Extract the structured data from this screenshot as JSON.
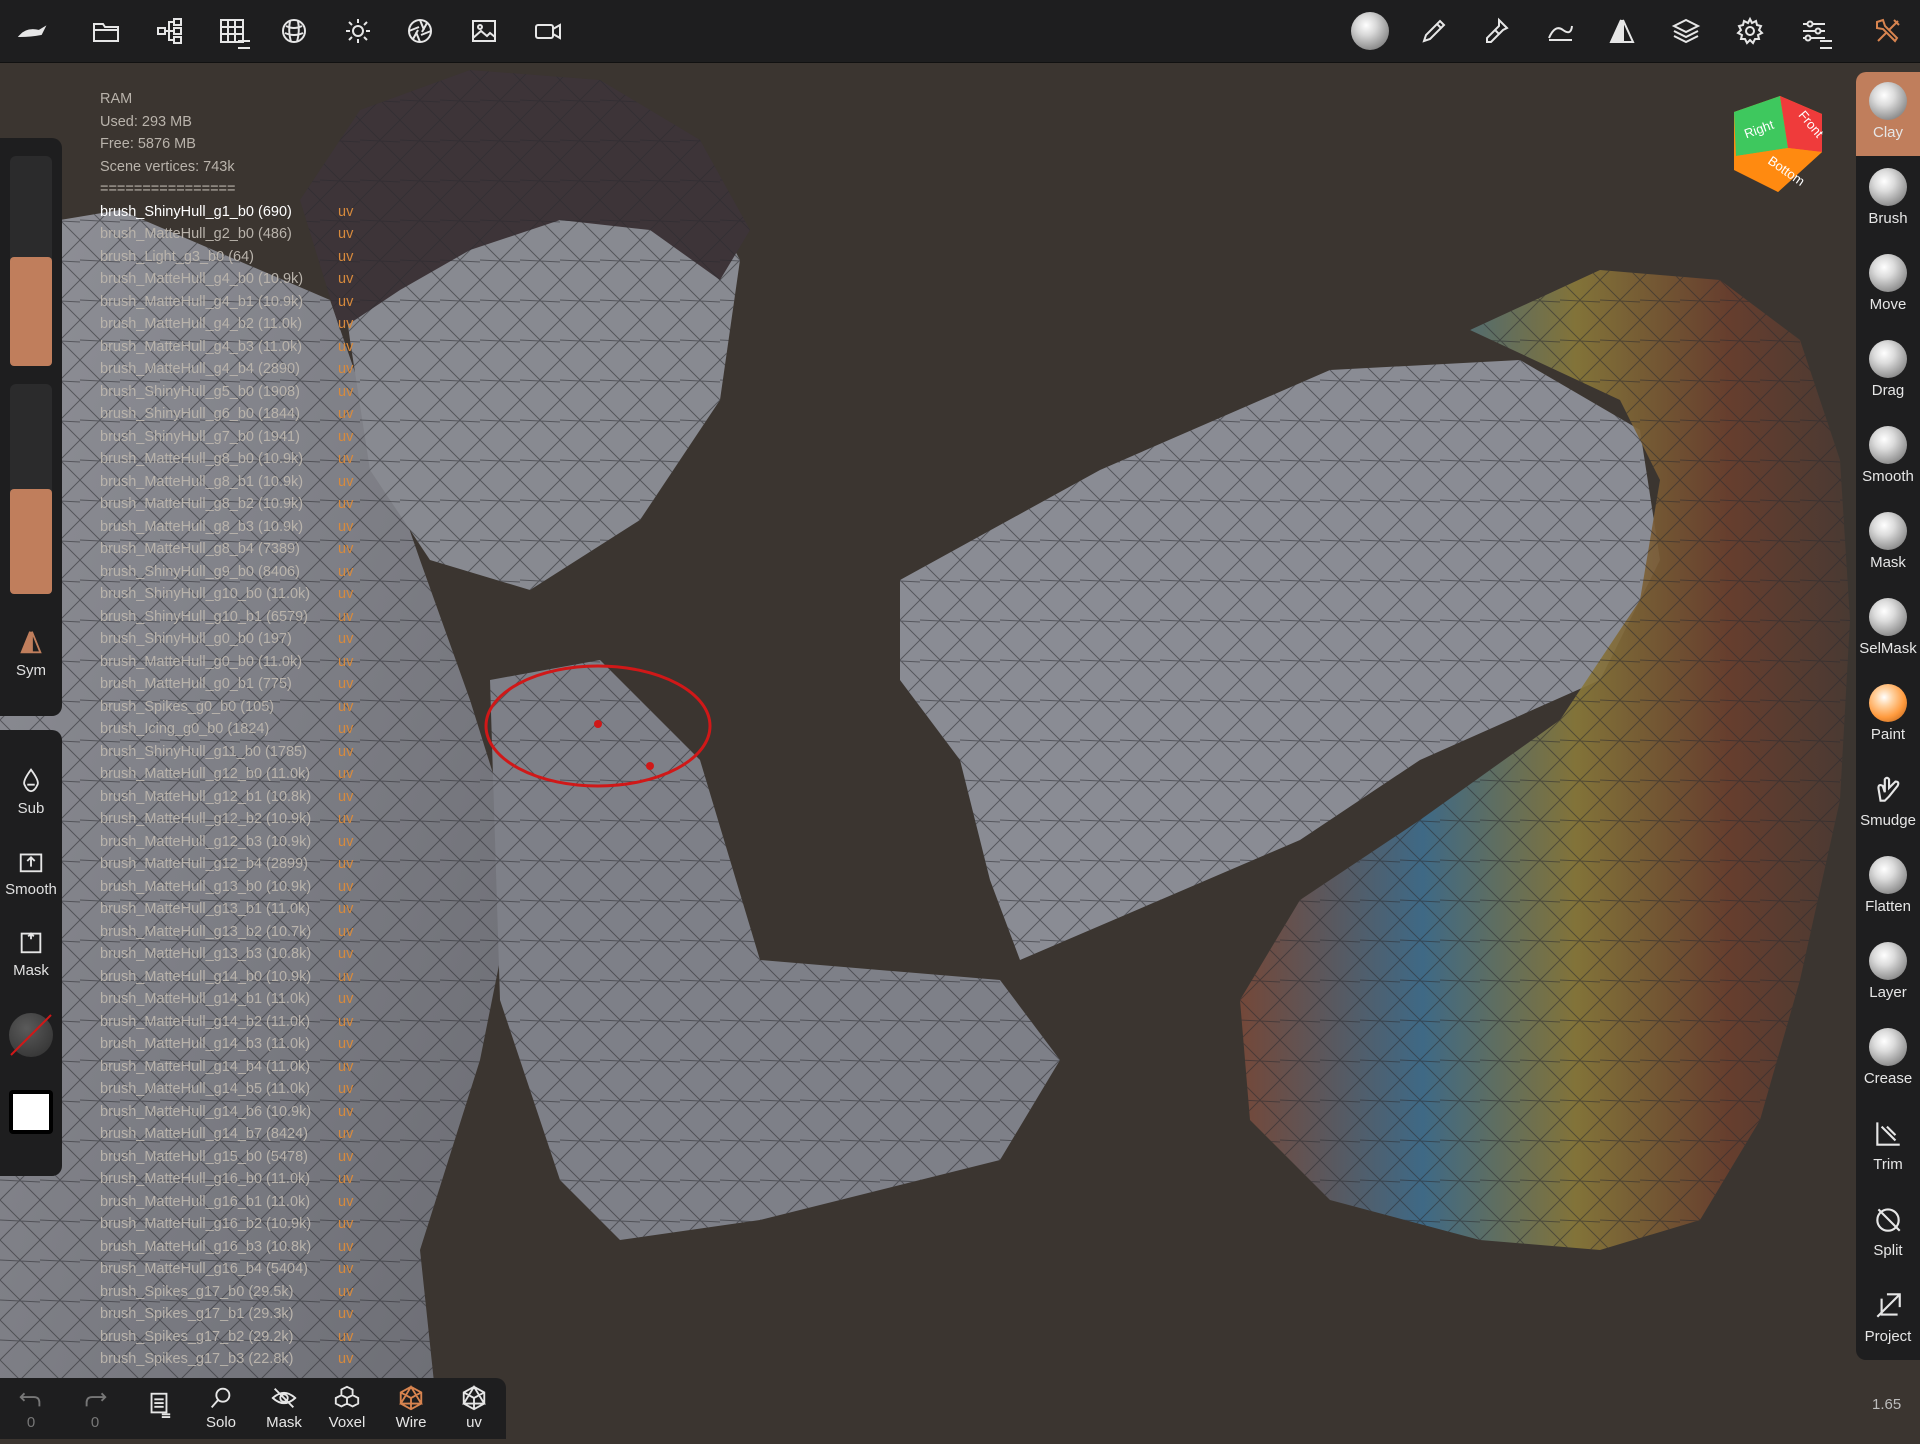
{
  "toolbar_top": {
    "left_icons": [
      "nomad-logo-icon",
      "folder-icon",
      "scene-tree-icon",
      "grid-icon",
      "material-sphere-icon",
      "light-sun-icon",
      "camera-aperture-icon",
      "image-icon",
      "video-camera-icon"
    ],
    "right_icons": [
      "matcap-sphere-icon",
      "brush-pencil-icon",
      "dropper-icon",
      "stroke-curve-icon",
      "symmetry-icon",
      "layers-icon",
      "settings-gear-icon",
      "sliders-icon",
      "tools-wrench-icon"
    ]
  },
  "stats": {
    "ram": "RAM",
    "used": "Used: 293 MB",
    "free": "Free: 5876 MB",
    "vertices": "Scene vertices: 743k",
    "separator": "================",
    "uv_tag": "uv",
    "meshes": [
      {
        "name": "brush_ShinyHull_g1_b0 (690)",
        "selected": true
      },
      {
        "name": "brush_MatteHull_g2_b0 (486)"
      },
      {
        "name": "brush_Light_g3_b0 (64)"
      },
      {
        "name": "brush_MatteHull_g4_b0 (10.9k)"
      },
      {
        "name": "brush_MatteHull_g4_b1 (10.9k)"
      },
      {
        "name": "brush_MatteHull_g4_b2 (11.0k)"
      },
      {
        "name": "brush_MatteHull_g4_b3 (11.0k)"
      },
      {
        "name": "brush_MatteHull_g4_b4 (2890)"
      },
      {
        "name": "brush_ShinyHull_g5_b0 (1908)"
      },
      {
        "name": "brush_ShinyHull_g6_b0 (1844)"
      },
      {
        "name": "brush_ShinyHull_g7_b0 (1941)"
      },
      {
        "name": "brush_MatteHull_g8_b0 (10.9k)"
      },
      {
        "name": "brush_MatteHull_g8_b1 (10.9k)"
      },
      {
        "name": "brush_MatteHull_g8_b2 (10.9k)"
      },
      {
        "name": "brush_MatteHull_g8_b3 (10.9k)"
      },
      {
        "name": "brush_MatteHull_g8_b4 (7389)"
      },
      {
        "name": "brush_ShinyHull_g9_b0 (8406)"
      },
      {
        "name": "brush_ShinyHull_g10_b0 (11.0k)"
      },
      {
        "name": "brush_ShinyHull_g10_b1 (6579)"
      },
      {
        "name": "brush_ShinyHull_g0_b0 (197)"
      },
      {
        "name": "brush_MatteHull_g0_b0 (11.0k)"
      },
      {
        "name": "brush_MatteHull_g0_b1 (775)"
      },
      {
        "name": "brush_Spikes_g0_b0 (105)"
      },
      {
        "name": "brush_Icing_g0_b0 (1824)"
      },
      {
        "name": "brush_ShinyHull_g11_b0 (1785)"
      },
      {
        "name": "brush_MatteHull_g12_b0 (11.0k)"
      },
      {
        "name": "brush_MatteHull_g12_b1 (10.8k)"
      },
      {
        "name": "brush_MatteHull_g12_b2 (10.9k)"
      },
      {
        "name": "brush_MatteHull_g12_b3 (10.9k)"
      },
      {
        "name": "brush_MatteHull_g12_b4 (2899)"
      },
      {
        "name": "brush_MatteHull_g13_b0 (10.9k)"
      },
      {
        "name": "brush_MatteHull_g13_b1 (11.0k)"
      },
      {
        "name": "brush_MatteHull_g13_b2 (10.7k)"
      },
      {
        "name": "brush_MatteHull_g13_b3 (10.8k)"
      },
      {
        "name": "brush_MatteHull_g14_b0 (10.9k)"
      },
      {
        "name": "brush_MatteHull_g14_b1 (11.0k)"
      },
      {
        "name": "brush_MatteHull_g14_b2 (11.0k)"
      },
      {
        "name": "brush_MatteHull_g14_b3 (11.0k)"
      },
      {
        "name": "brush_MatteHull_g14_b4 (11.0k)"
      },
      {
        "name": "brush_MatteHull_g14_b5 (11.0k)"
      },
      {
        "name": "brush_MatteHull_g14_b6 (10.9k)"
      },
      {
        "name": "brush_MatteHull_g14_b7 (8424)"
      },
      {
        "name": "brush_MatteHull_g15_b0 (5478)"
      },
      {
        "name": "brush_MatteHull_g16_b0 (11.0k)"
      },
      {
        "name": "brush_MatteHull_g16_b1 (11.0k)"
      },
      {
        "name": "brush_MatteHull_g16_b2 (10.9k)"
      },
      {
        "name": "brush_MatteHull_g16_b3 (10.8k)"
      },
      {
        "name": "brush_MatteHull_g16_b4 (5404)"
      },
      {
        "name": "brush_Spikes_g17_b0 (29.5k)"
      },
      {
        "name": "brush_Spikes_g17_b1 (29.3k)"
      },
      {
        "name": "brush_Spikes_g17_b2 (29.2k)"
      },
      {
        "name": "brush_Spikes_g17_b3 (22.8k)"
      }
    ]
  },
  "left_panel": {
    "radius_level": 0.52,
    "intensity_level": 0.5,
    "sym_label": "Sym",
    "sub_label": "Sub",
    "smooth_label": "Smooth",
    "mask_label": "Mask"
  },
  "right_tools": [
    {
      "label": "Clay",
      "active": true,
      "icon": "clay-sphere-icon"
    },
    {
      "label": "Brush",
      "icon": "brush-sphere-icon"
    },
    {
      "label": "Move",
      "icon": "move-sphere-icon"
    },
    {
      "label": "Drag",
      "icon": "drag-sphere-icon"
    },
    {
      "label": "Smooth",
      "icon": "smooth-sphere-icon"
    },
    {
      "label": "Mask",
      "icon": "mask-sphere-icon"
    },
    {
      "label": "SelMask",
      "icon": "selmask-sphere-icon"
    },
    {
      "label": "Paint",
      "icon": "paint-sphere-icon"
    },
    {
      "label": "Smudge",
      "icon": "smudge-hand-icon"
    },
    {
      "label": "Flatten",
      "icon": "flatten-sphere-icon"
    },
    {
      "label": "Layer",
      "icon": "layer-sphere-icon"
    },
    {
      "label": "Crease",
      "icon": "crease-sphere-icon"
    },
    {
      "label": "Trim",
      "icon": "trim-icon"
    },
    {
      "label": "Split",
      "icon": "split-icon"
    },
    {
      "label": "Project",
      "icon": "project-icon"
    }
  ],
  "bottom_bar": {
    "undo_count": "0",
    "redo_count": "0",
    "solo": "Solo",
    "mask": "Mask",
    "voxel": "Voxel",
    "wire": "Wire",
    "uv": "uv"
  },
  "nav_cube": {
    "right": "Right",
    "front": "Front",
    "bottom": "Bottom"
  },
  "zoom_value": "1.65",
  "colors": {
    "accent": "#c07e5c",
    "uv": "#d88a3c",
    "panel": "#1e1e1f",
    "background": "#3b3530",
    "selection_circle": "#d01818"
  }
}
